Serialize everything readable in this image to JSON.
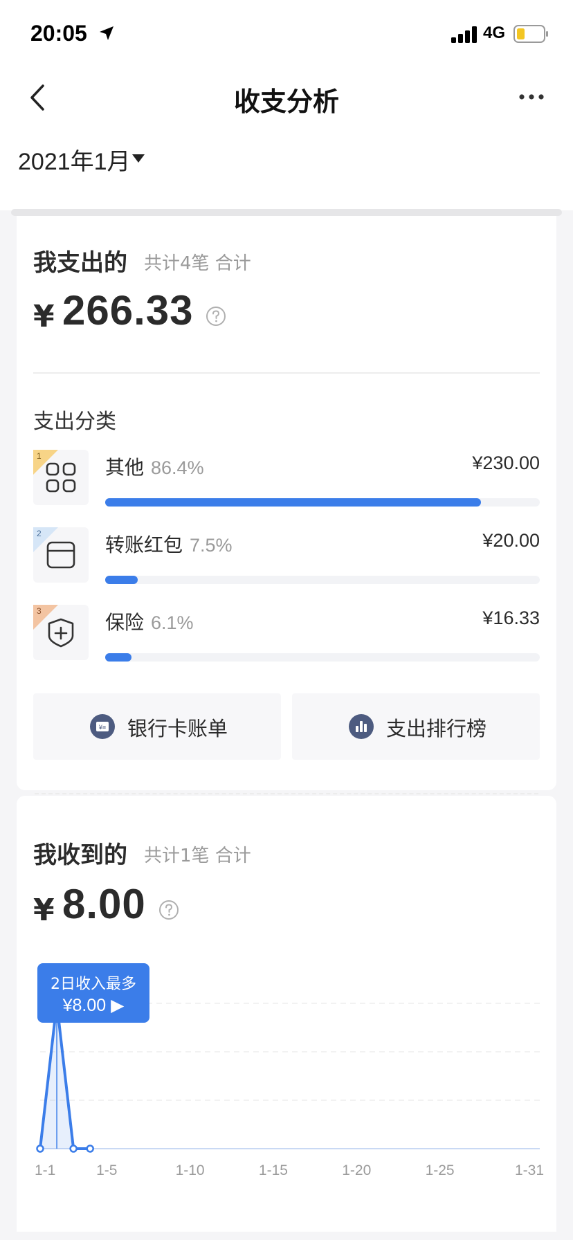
{
  "status_bar": {
    "time": "20:05",
    "network": "4G"
  },
  "nav": {
    "title": "收支分析"
  },
  "filter": {
    "month": "2021年1月"
  },
  "expense": {
    "title": "我支出的",
    "summary": "共计4笔 合计",
    "currency": "¥",
    "total": "266.33",
    "category_title": "支出分类",
    "categories": [
      {
        "rank": "1",
        "name": "其他",
        "percent": "86.4%",
        "amount": "¥230.00",
        "share": 0.864,
        "icon": "grid-icon",
        "rank_color": "#f7d487"
      },
      {
        "rank": "2",
        "name": "转账红包",
        "percent": "7.5%",
        "amount": "¥20.00",
        "share": 0.075,
        "icon": "wallet-icon",
        "rank_color": "#d6e6f7"
      },
      {
        "rank": "3",
        "name": "保险",
        "percent": "6.1%",
        "amount": "¥16.33",
        "share": 0.061,
        "icon": "shield-plus-icon",
        "rank_color": "#f3c4a2"
      }
    ],
    "buttons": [
      {
        "label": "银行卡账单",
        "icon": "bank-bill-icon"
      },
      {
        "label": "支出排行榜",
        "icon": "bar-chart-icon"
      }
    ]
  },
  "income": {
    "title": "我收到的",
    "summary": "共计1笔 合计",
    "currency": "¥",
    "total": "8.00",
    "tooltip_title": "2日收入最多",
    "tooltip_value": "¥8.00 ▶"
  },
  "colors": {
    "accent": "#3b7de9",
    "bar_track": "#f2f3f6"
  },
  "chart_data": {
    "type": "line",
    "x": [
      "1-1",
      "1-2",
      "1-3",
      "1-4",
      "1-5"
    ],
    "values": [
      0,
      8,
      0,
      0,
      null
    ],
    "x_range": [
      1,
      31
    ],
    "xticks": [
      "1-1",
      "1-5",
      "1-10",
      "1-15",
      "1-20",
      "1-25",
      "1-31"
    ],
    "ylim": [
      0,
      8
    ],
    "grid": true
  }
}
